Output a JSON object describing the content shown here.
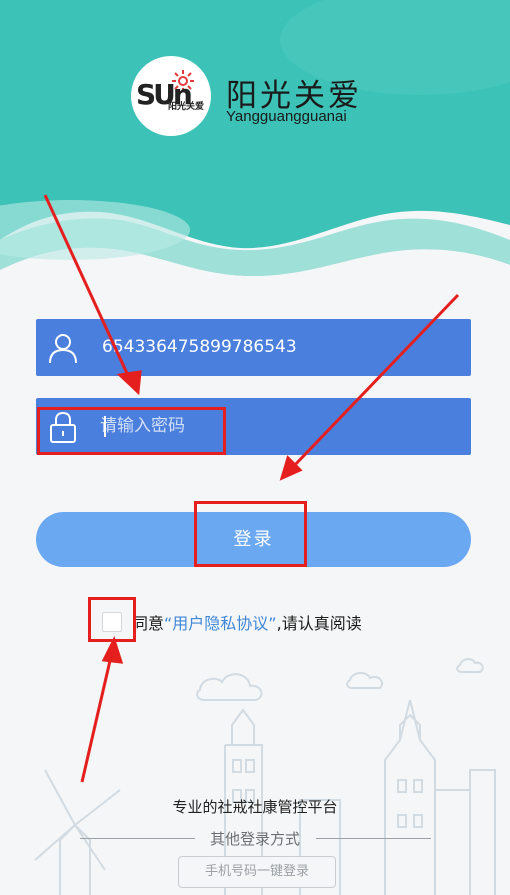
{
  "brand": {
    "logo_text": "SUn",
    "logo_mini": "阳光关爱",
    "title": "阳光关爱",
    "subtitle": "Yangguangguanai"
  },
  "login": {
    "username_value": "654336475899786543",
    "password_placeholder": "请输入密码",
    "submit_label": "登录"
  },
  "agreement": {
    "prefix": "同意",
    "link": "“用户隐私协议”",
    "suffix": ",请认真阅读"
  },
  "footer": {
    "platform": "专业的社戒社康管控平台",
    "other_login": "其他登录方式",
    "phone_login": "手机号码一键登录"
  },
  "colors": {
    "header_teal": "#3cc2b6",
    "field_blue": "#4a7fde",
    "button_blue": "#6aa8f2",
    "highlight_red": "#e51e1e",
    "link_blue": "#3f87d8"
  }
}
